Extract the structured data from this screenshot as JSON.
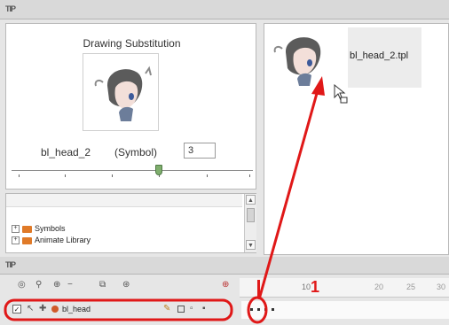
{
  "top_strip": {
    "grip_label": "TIP"
  },
  "substitution": {
    "title": "Drawing Substitution",
    "drawing_name": "bl_head_2",
    "symbol_label": "(Symbol)",
    "frame_value": "3",
    "slider_level_fraction": 0.62
  },
  "preview": {
    "file_label": "bl_head_2.tpl"
  },
  "library": {
    "items": [
      {
        "label": "Symbols"
      },
      {
        "label": "Animate Library"
      }
    ]
  },
  "timeline": {
    "grip_label": "TIP",
    "layer_name": "bl_head",
    "ruler_labels": [
      "10",
      "1",
      "20",
      "25",
      "30"
    ]
  },
  "colors": {
    "annotation": "#e01818",
    "folder": "#e07a28",
    "slider_thumb": "#7fae6d"
  }
}
